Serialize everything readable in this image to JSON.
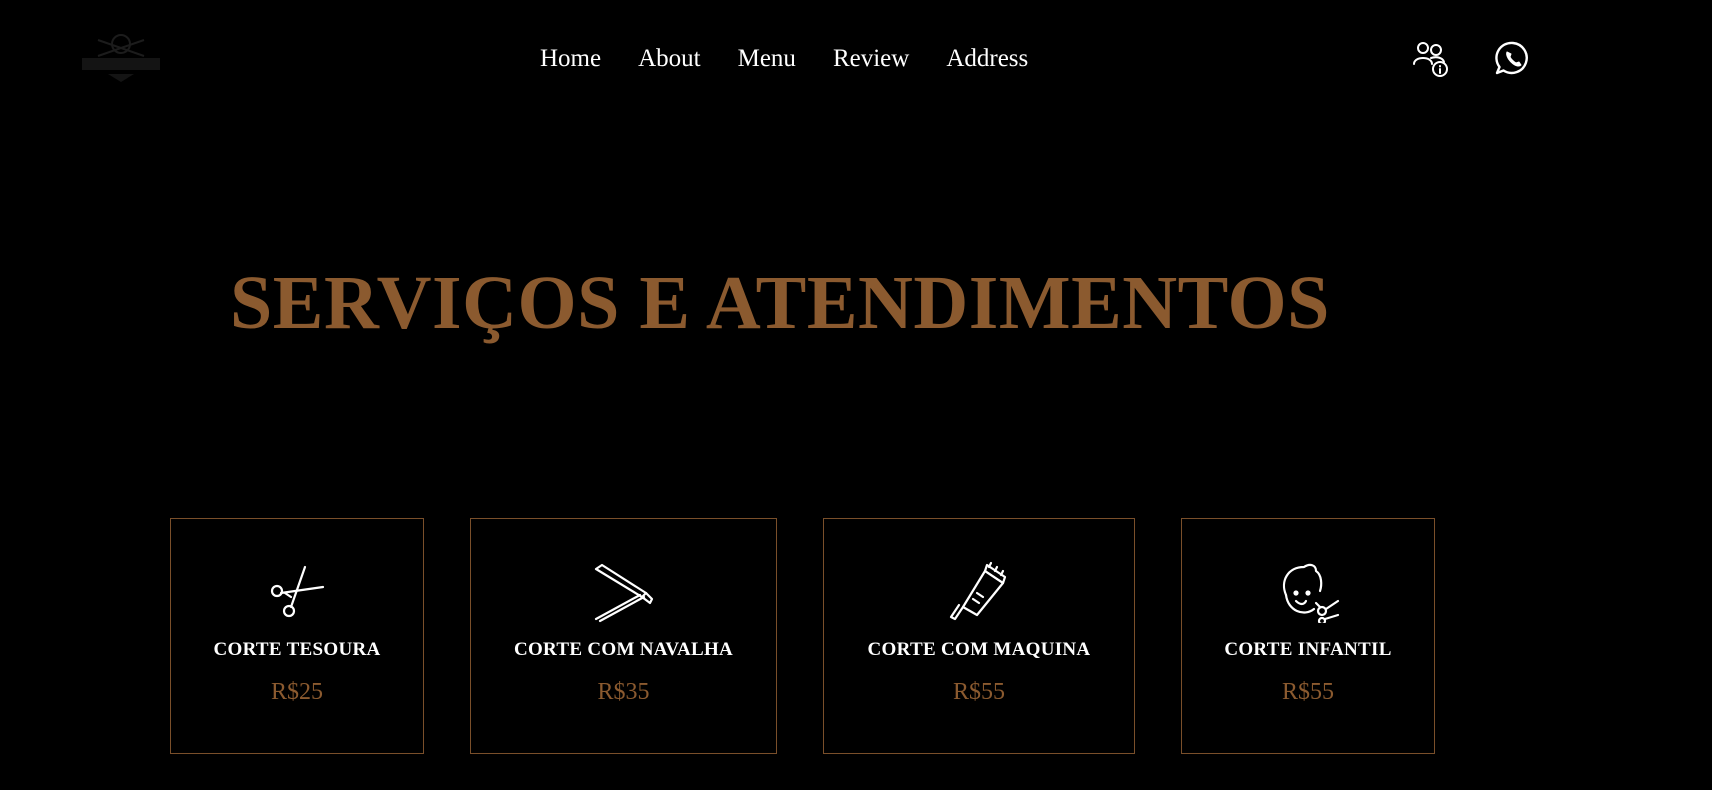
{
  "header": {
    "logo_icon": "barbershop-logo",
    "nav": [
      {
        "label": "Home"
      },
      {
        "label": "About"
      },
      {
        "label": "Menu"
      },
      {
        "label": "Review"
      },
      {
        "label": "Address"
      }
    ],
    "users_icon": "users-info-icon",
    "whatsapp_icon": "whatsapp-icon"
  },
  "hero": {
    "title": "SERVIÇOS E ATENDIMENTOS"
  },
  "services": [
    {
      "icon": "scissors-icon",
      "title": "CORTE TESOURA",
      "price": "R$25"
    },
    {
      "icon": "razor-icon",
      "title": "CORTE COM NAVALHA",
      "price": "R$35"
    },
    {
      "icon": "clipper-icon",
      "title": "CORTE COM MAQUINA",
      "price": "R$55"
    },
    {
      "icon": "kid-haircut-icon",
      "title": "CORTE INFANTIL",
      "price": "R$55"
    }
  ],
  "colors": {
    "background": "#000000",
    "accent": "#8b5a2f",
    "text": "#ffffff",
    "card_border": "#7a4f2a"
  }
}
